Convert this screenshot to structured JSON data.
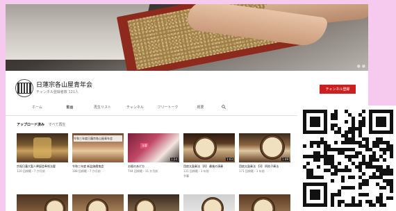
{
  "channel": {
    "name": "日蓮宗各山屋青年会",
    "subscribers": "チャンネル登録者数 121人",
    "subscribe_label": "チャンネル登録"
  },
  "tabs": [
    {
      "label": "ホーム",
      "active": false
    },
    {
      "label": "動画",
      "active": true
    },
    {
      "label": "再生リスト",
      "active": false
    },
    {
      "label": "チャンネル",
      "active": false
    },
    {
      "label": "フリートーク",
      "active": false
    },
    {
      "label": "概要",
      "active": false
    }
  ],
  "search_icon": "search-icon",
  "section": {
    "title": "アップロード済み",
    "play_all": "すべて再生"
  },
  "videos": [
    {
      "title": "宗祖日蓮大聖人降誕会奉祝法要",
      "meta": "120 回視聴・7 か月前",
      "duration": "",
      "extra": ""
    },
    {
      "title": "令和三年度 新盆施餓鬼会",
      "meta": "188 回視聴・7 か月前",
      "duration": "",
      "banner_text": "令和三年度日蓮宗各山屋青年会"
    },
    {
      "title": "お経のあげ方",
      "meta": "744 回視聴・11 か月前",
      "duration": "1:24",
      "tag": "法要"
    },
    {
      "title": "団扇太鼓奏法 【4】 最後の演奏",
      "meta": "131 回視聴・1 年前",
      "duration": "1:03",
      "extra": "字幕"
    },
    {
      "title": "団扇太鼓奏法 【3】 四拍子奏法",
      "meta": "171 回視聴・1 年前",
      "duration": "1:49",
      "extra": ""
    }
  ],
  "qr_code": "qr-code"
}
